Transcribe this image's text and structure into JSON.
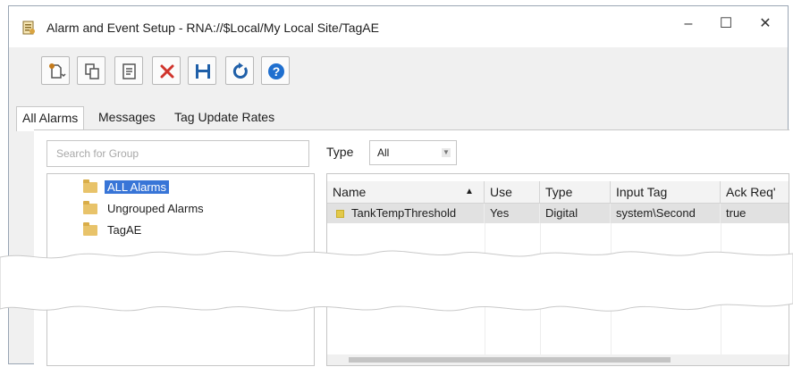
{
  "window": {
    "title": "Alarm and Event Setup - RNA://$Local/My Local Site/TagAE",
    "minimize_glyph": "–",
    "maximize_glyph": "☐",
    "close_glyph": "✕"
  },
  "toolbar": {
    "buttons": [
      {
        "name": "new-dropdown-icon",
        "color": "#c47a1a"
      },
      {
        "name": "copy-icon",
        "color": "#555555"
      },
      {
        "name": "properties-icon",
        "color": "#555555"
      },
      {
        "name": "delete-icon",
        "color": "#d0342c"
      },
      {
        "name": "save-icon",
        "color": "#1f5fa8"
      },
      {
        "name": "refresh-icon",
        "color": "#1f5fa8"
      },
      {
        "name": "help-icon",
        "color": "#1f6fcf"
      }
    ]
  },
  "tabs": [
    {
      "label": "All Alarms",
      "active": true
    },
    {
      "label": "Messages",
      "active": false
    },
    {
      "label": "Tag Update Rates",
      "active": false
    }
  ],
  "filter": {
    "search_placeholder": "Search for Group",
    "type_label": "Type",
    "type_value": "All"
  },
  "tree": {
    "items": [
      {
        "label": "ALL Alarms",
        "selected": true
      },
      {
        "label": "Ungrouped Alarms",
        "selected": false
      },
      {
        "label": "TagAE",
        "selected": false
      }
    ]
  },
  "grid": {
    "columns": [
      "Name",
      "Use",
      "Type",
      "Input Tag",
      "Ack Req'"
    ],
    "sort_glyph": "▲",
    "rows": [
      {
        "name": "TankTempThreshold",
        "use": "Yes",
        "type": "Digital",
        "input_tag": "system\\Second",
        "ack_req": "true"
      }
    ]
  }
}
